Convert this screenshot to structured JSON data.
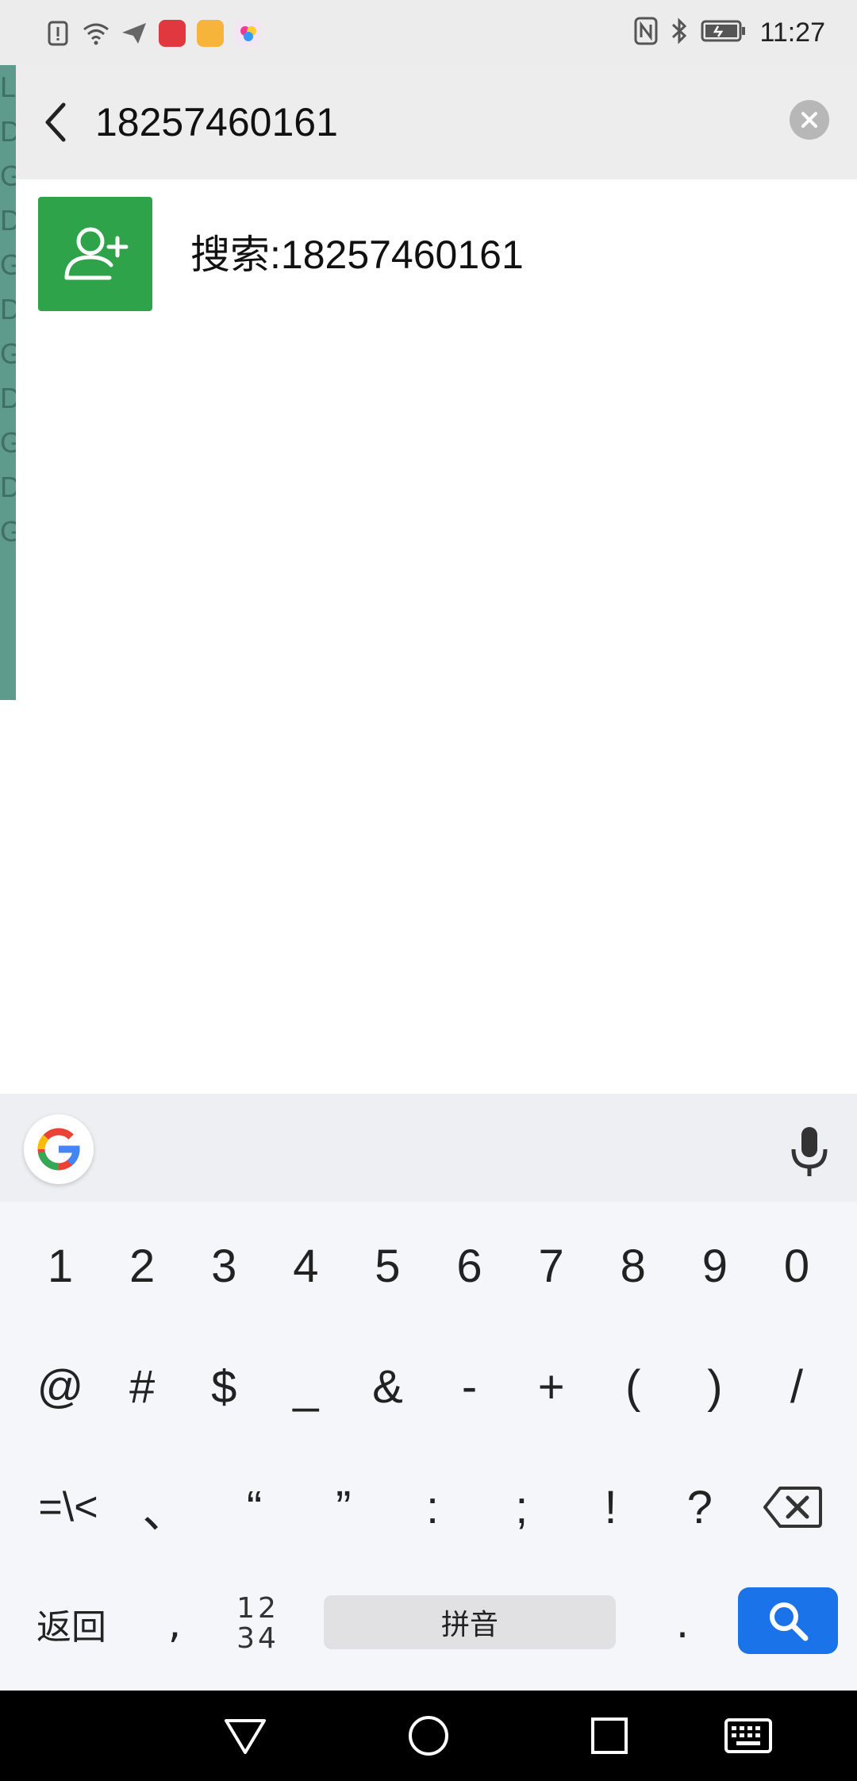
{
  "status_bar": {
    "time": "11:27",
    "left_icons": [
      "alert-icon",
      "wifi-icon",
      "send-icon",
      "huawei-app-icon",
      "yellow-app-icon",
      "photos-app-icon"
    ],
    "right_icons": [
      "nfc-icon",
      "bluetooth-icon",
      "battery-icon"
    ]
  },
  "left_strip": {
    "letters": [
      "L",
      "D",
      "G",
      "D",
      "G",
      "D",
      "G",
      "D",
      "G",
      "D",
      "G"
    ]
  },
  "search": {
    "query": "18257460161"
  },
  "results": [
    {
      "icon": "add-contact-icon",
      "label": "搜索:18257460161"
    }
  ],
  "keyboard": {
    "row1": [
      "1",
      "2",
      "3",
      "4",
      "5",
      "6",
      "7",
      "8",
      "9",
      "0"
    ],
    "row2": [
      "@",
      "#",
      "$",
      "_",
      "&",
      "-",
      "+",
      "(",
      ")",
      "/"
    ],
    "row3": [
      "=\\<",
      "、",
      "“",
      "”",
      ":",
      ";",
      "!",
      "?"
    ],
    "return_label": "返回",
    "comma": ",",
    "numpad_top": "12",
    "numpad_bottom": "34",
    "space_label": "拼音",
    "period": ".",
    "accent": "#1a73e8"
  },
  "colors": {
    "avatar_green": "#2ea34a",
    "strip_teal": "#5f9b8d"
  }
}
